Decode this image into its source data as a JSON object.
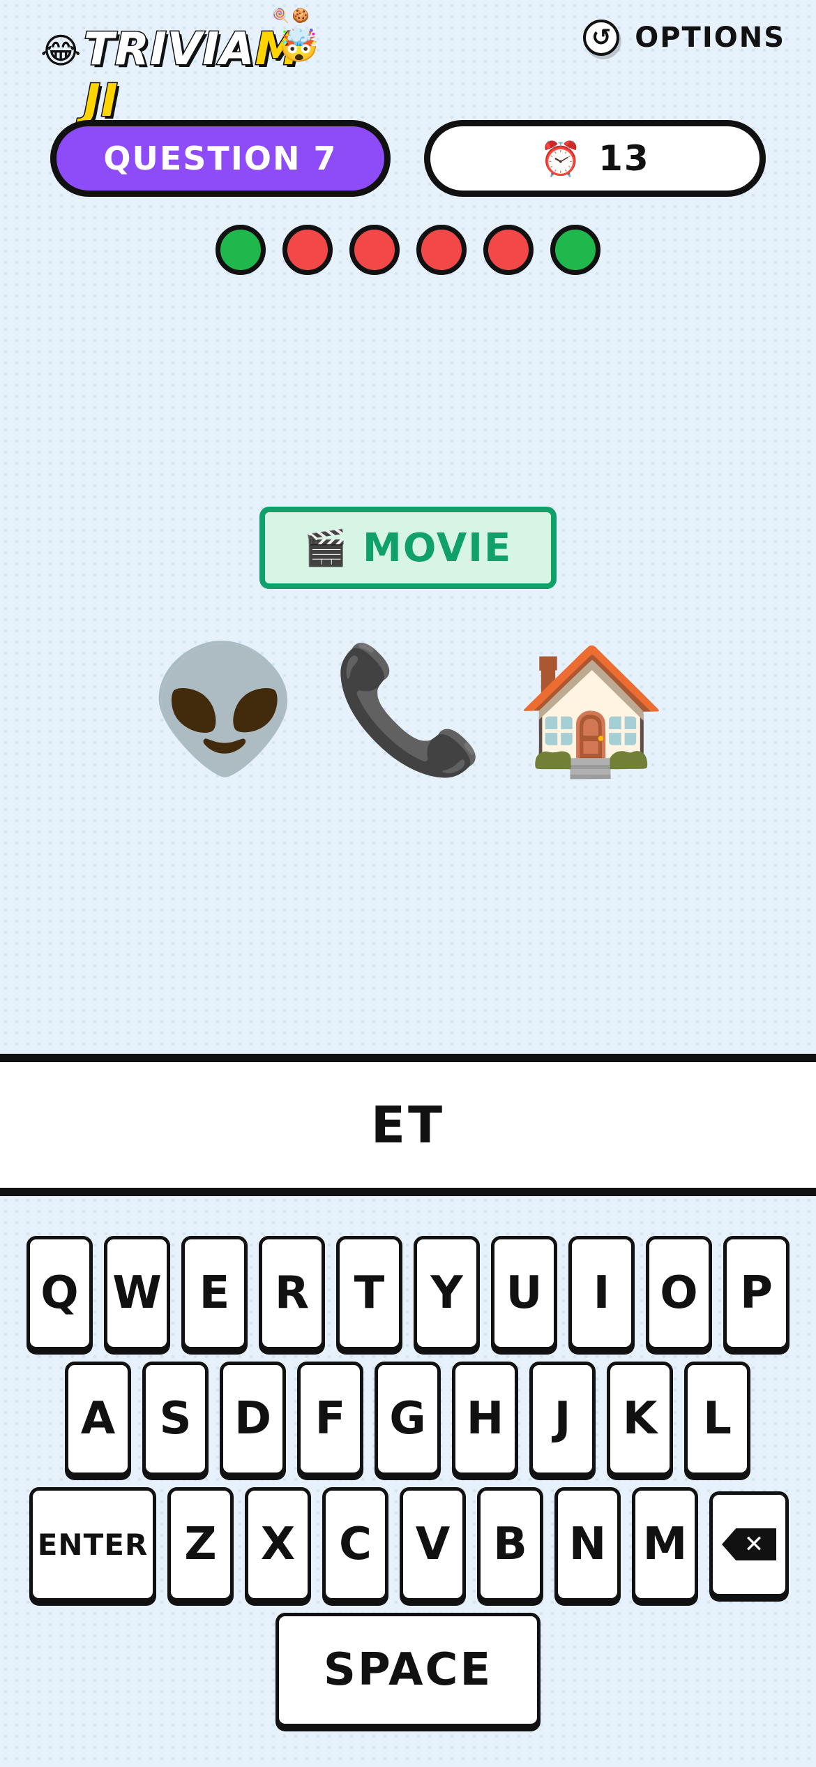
{
  "header": {
    "logo": {
      "lead_emoji": "😂",
      "text_part1": "TRIVIA",
      "text_part2": "M",
      "text_part3": "JI",
      "mid_emoji": "🤯",
      "sparks": "🍭🍪"
    },
    "options": {
      "icon": "timer-circle-icon",
      "icon_glyph": "↺",
      "label": "OPTIONS"
    }
  },
  "question": {
    "label": "QUESTION 7"
  },
  "timer": {
    "icon_glyph": "⏰",
    "value": "13"
  },
  "progress": {
    "results": [
      "correct",
      "wrong",
      "wrong",
      "wrong",
      "wrong",
      "correct"
    ],
    "colors": {
      "correct": "#1fb84d",
      "wrong": "#f24848"
    }
  },
  "category": {
    "icon_glyph": "🎬",
    "label": "MOVIE"
  },
  "clue": {
    "emojis": [
      "👽",
      "📞",
      "🏠"
    ]
  },
  "answer": {
    "text": "ET"
  },
  "keyboard": {
    "row1": [
      "Q",
      "W",
      "E",
      "R",
      "T",
      "Y",
      "U",
      "I",
      "O",
      "P"
    ],
    "row2": [
      "A",
      "S",
      "D",
      "F",
      "G",
      "H",
      "J",
      "K",
      "L"
    ],
    "row3": [
      "Z",
      "X",
      "C",
      "V",
      "B",
      "N",
      "M"
    ],
    "enter_label": "ENTER",
    "backspace_icon": "backspace-icon",
    "backspace_glyph": "✕",
    "space_label": "SPACE"
  },
  "colors": {
    "accent_purple": "#8d4cf7",
    "category_green": "#10a06a",
    "background": "#e6f1fb"
  }
}
